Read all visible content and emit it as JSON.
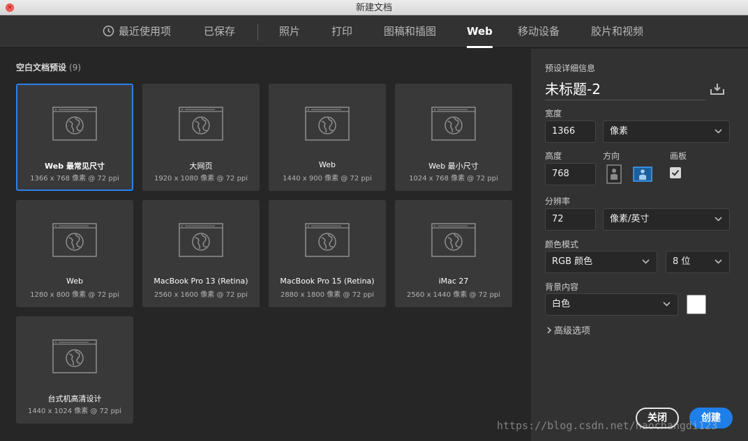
{
  "window": {
    "title": "新建文档"
  },
  "tabs": [
    {
      "label": "最近使用项",
      "active": false
    },
    {
      "label": "已保存",
      "active": false
    },
    {
      "label": "照片",
      "active": false
    },
    {
      "label": "打印",
      "active": false
    },
    {
      "label": "图稿和插图",
      "active": false
    },
    {
      "label": "Web",
      "active": true
    },
    {
      "label": "移动设备",
      "active": false
    },
    {
      "label": "胶片和视频",
      "active": false
    }
  ],
  "presets": {
    "title": "空白文档预设",
    "count": "(9)",
    "items": [
      {
        "name": "Web 最常见尺寸",
        "spec": "1366 x 768 像素 @ 72 ppi",
        "selected": true
      },
      {
        "name": "大网页",
        "spec": "1920 x 1080 像素 @ 72 ppi",
        "selected": false
      },
      {
        "name": "Web",
        "spec": "1440 x 900 像素 @ 72 ppi",
        "selected": false
      },
      {
        "name": "Web 最小尺寸",
        "spec": "1024 x 768 像素 @ 72 ppi",
        "selected": false
      },
      {
        "name": "Web",
        "spec": "1280 x 800 像素 @ 72 ppi",
        "selected": false
      },
      {
        "name": "MacBook Pro 13 (Retina)",
        "spec": "2560 x 1600 像素 @ 72 ppi",
        "selected": false
      },
      {
        "name": "MacBook Pro 15 (Retina)",
        "spec": "2880 x 1800 像素 @ 72 ppi",
        "selected": false
      },
      {
        "name": "iMac 27",
        "spec": "2560 x 1440 像素 @ 72 ppi",
        "selected": false
      },
      {
        "name": "台式机高清设计",
        "spec": "1440 x 1024 像素 @ 72 ppi",
        "selected": false
      }
    ]
  },
  "details": {
    "heading": "预设详细信息",
    "doc_name": "未标题-2",
    "width_label": "宽度",
    "width_value": "1366",
    "width_unit": "像素",
    "height_label": "高度",
    "height_value": "768",
    "orientation_label": "方向",
    "orientation": "landscape",
    "artboard_label": "画板",
    "artboard_checked": true,
    "resolution_label": "分辨率",
    "resolution_value": "72",
    "resolution_unit": "像素/英寸",
    "color_mode_label": "颜色模式",
    "color_mode": "RGB 颜色",
    "bit_depth": "8 位",
    "background_label": "背景内容",
    "background": "白色",
    "background_color": "#ffffff",
    "advanced_label": "高级选项"
  },
  "buttons": {
    "close": "关闭",
    "create": "创建"
  },
  "watermark": "https://blog.csdn.net/haochangdi123",
  "colors": {
    "accent": "#1f7fe8",
    "selection": "#2d7fea"
  }
}
